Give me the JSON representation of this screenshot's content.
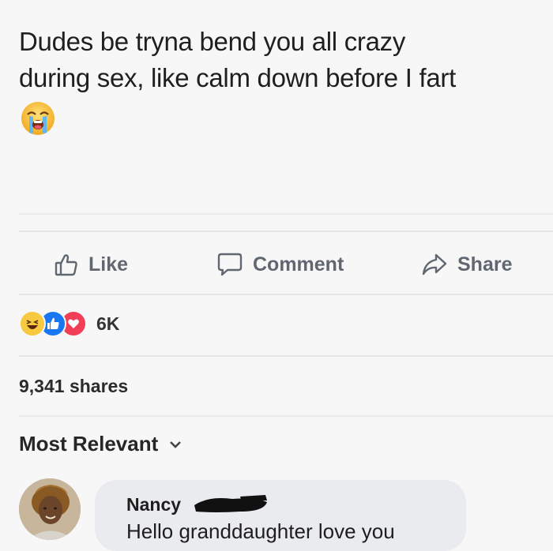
{
  "post": {
    "line1": "Dudes be tryna bend you all crazy",
    "line2": "during sex, like calm down before I fart",
    "emoji": "loudly-crying-face-emoji"
  },
  "actions": {
    "like": "Like",
    "comment": "Comment",
    "share": "Share"
  },
  "reactions": {
    "icons": [
      "haha-reaction-icon",
      "like-reaction-icon",
      "love-reaction-icon"
    ],
    "count": "6K"
  },
  "shares": "9,341 shares",
  "sort": {
    "label": "Most Relevant",
    "icon": "chevron-down-icon"
  },
  "comment": {
    "author": "Nancy",
    "text": "Hello granddaughter love you"
  },
  "colors": {
    "background": "#f7f7f8",
    "action_text": "#606770",
    "like_blue": "#1877f2",
    "love_red": "#f33e58",
    "haha_yellow": "#f7c940",
    "bubble": "#eaebee"
  }
}
